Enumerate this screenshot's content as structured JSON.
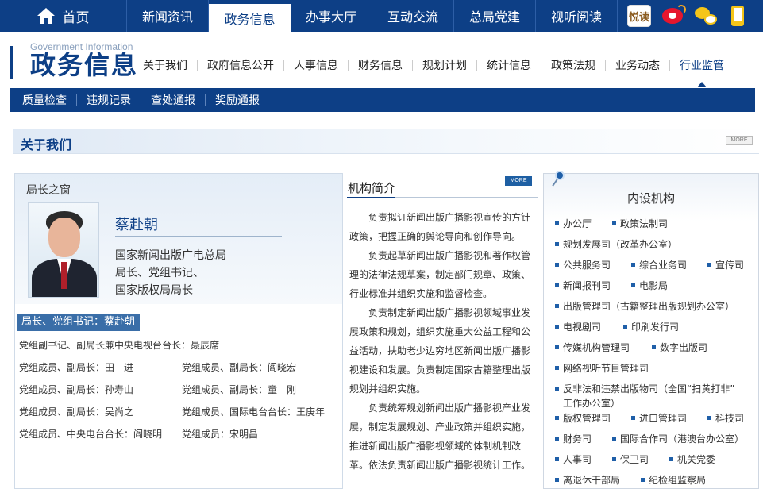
{
  "topnav": {
    "home": "首页",
    "items": [
      "新闻资讯",
      "政务信息",
      "办事大厅",
      "互动交流",
      "总局党建",
      "视听阅读"
    ],
    "active_index": 1,
    "socials": [
      "阅读",
      "weibo",
      "wechat",
      "mobile"
    ]
  },
  "logo": {
    "en": "Government Information",
    "cn": "政务信息"
  },
  "secnav": [
    "关于我们",
    "政府信息公开",
    "人事信息",
    "财务信息",
    "规划计划",
    "统计信息",
    "政策法规",
    "业务动态",
    "行业监管"
  ],
  "subnav": [
    "质量检查",
    "违规记录",
    "查处通报",
    "奖励通报"
  ],
  "section": {
    "title": "关于我们",
    "more": "MORE"
  },
  "leader": {
    "window_title": "局长之窗",
    "name": "蔡赴朝",
    "titles": [
      "国家新闻出版广电总局",
      "局长、党组书记、",
      "国家版权局局长"
    ],
    "badge": "局长、党组书记：蔡赴朝",
    "members": [
      "党组副书记、副局长兼中央电视台台长：聂辰席",
      "党组成员、副局长：田　进",
      "党组成员、副局长：阎晓宏",
      "党组成员、副局长：孙寿山",
      "党组成员、副局长：童　刚",
      "党组成员、副局长：吴尚之",
      "党组成员、国际电台台长：王庚年",
      "党组成员、中央电台台长：阎晓明",
      "党组成员：宋明昌"
    ]
  },
  "intro": {
    "title": "机构简介",
    "more": "MORE",
    "paragraphs": [
      "负责拟订新闻出版广播影视宣传的方针政策，把握正确的舆论导向和创作导向。",
      "负责起草新闻出版广播影视和著作权管理的法律法规草案，制定部门规章、政策、行业标准并组织实施和监督检查。",
      "负责制定新闻出版广播影视领域事业发展政策和规划，组织实施重大公益工程和公益活动，扶助老少边穷地区新闻出版广播影视建设和发展。负责制定国家古籍整理出版规划并组织实施。",
      "负责统筹规划新闻出版广播影视产业发展，制定发展规划、产业政策并组织实施，推进新闻出版广播影视领域的体制机制改革。依法负责新闻出版广播影视统计工作。"
    ]
  },
  "depts": {
    "title": "内设机构",
    "items": [
      "办公厅",
      "政策法制司",
      "规划发展司（改革办公室）",
      "公共服务司",
      "综合业务司",
      "宣传司",
      "新闻报刊司",
      "电影局",
      "出版管理司（古籍整理出版规划办公室）",
      "电视剧司",
      "印刷发行司",
      "传媒机构管理司",
      "数字出版司",
      "网络视听节目管理司",
      "反非法和违禁出版物司（全国“扫黄打非”",
      "工作办公室）",
      "版权管理司",
      "进口管理司",
      "科技司",
      "财务司",
      "国际合作司（港澳台办公室）",
      "人事司",
      "保卫司",
      "机关党委",
      "离退休干部局",
      "纪检组监察局"
    ]
  }
}
